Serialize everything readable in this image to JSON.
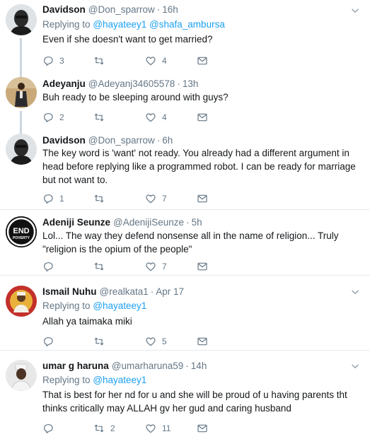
{
  "tweets": [
    {
      "name": "Davidson",
      "handle": "@Don_sparrow",
      "time": "16h",
      "replying_prefix": "Replying to",
      "replying_to": "@hayateey1 @shafa_ambursa",
      "text": "Even if she doesn't want to get married?",
      "replies": "3",
      "retweets": "",
      "likes": "4"
    },
    {
      "name": "Adeyanju",
      "handle": "@Adeyanj34605578",
      "time": "13h",
      "text": "Buh ready to be sleeping around with guys?",
      "replies": "2",
      "retweets": "",
      "likes": "4"
    },
    {
      "name": "Davidson",
      "handle": "@Don_sparrow",
      "time": "6h",
      "text": "The key word is 'want' not ready. You already had a different argument in head before replying like a programmed robot. I can be ready for marriage but not want to.",
      "replies": "1",
      "retweets": "",
      "likes": "7"
    },
    {
      "name": "Adeniji Seunze",
      "handle": "@AdenijiSeunze",
      "time": "5h",
      "text": "Lol... The way they defend nonsense all in the name of religion... Truly \"religion is the opium of the people\"",
      "replies": "",
      "retweets": "",
      "likes": "7",
      "avatar_text_1": "END",
      "avatar_text_2": "POVERTY"
    },
    {
      "name": "Ismail Nuhu",
      "handle": "@realkata1",
      "time": "Apr 17",
      "replying_prefix": "Replying to",
      "replying_to": "@hayateey1",
      "text": "Allah ya taimaka miki",
      "replies": "",
      "retweets": "",
      "likes": "5"
    },
    {
      "name": "umar g haruna",
      "handle": "@umarharuna59",
      "time": "14h",
      "replying_prefix": "Replying to",
      "replying_to": "@hayateey1",
      "text": "That is best for her nd for u and she will be proud of u having parents tht thinks critically may ALLAH gv her gud and caring husband",
      "replies": "",
      "retweets": "2",
      "likes": "11"
    }
  ],
  "icons": {
    "reply": "reply-icon",
    "retweet": "retweet-icon",
    "like": "heart-icon",
    "dm": "envelope-icon",
    "more": "chevron-down-icon"
  },
  "colors": {
    "link": "#1da1f2",
    "secondary_text": "#657786",
    "divider": "#e6ecf0",
    "thread_line": "#ccd6dd"
  }
}
